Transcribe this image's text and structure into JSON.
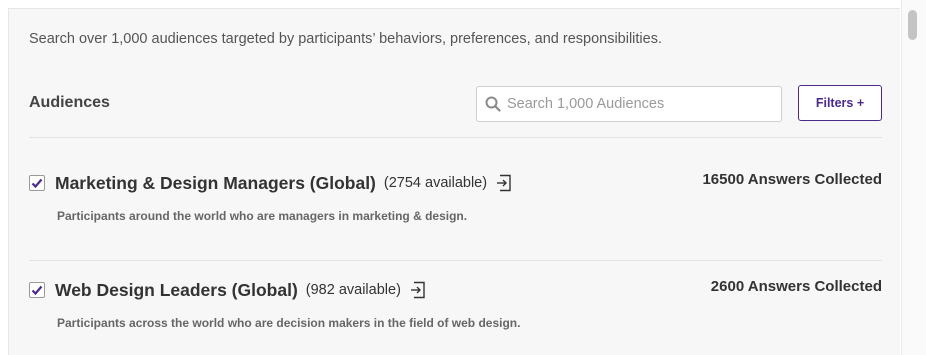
{
  "intro_text": "Search over 1,000 audiences targeted by participants’ behaviors, preferences, and responsibilities.",
  "section_title": "Audiences",
  "search": {
    "placeholder": "Search 1,000 Audiences",
    "icon": "search-icon"
  },
  "filters_label": "Filters +",
  "accent_color": "#4b2a8a",
  "audiences": [
    {
      "name": "Marketing & Design Managers (Global)",
      "available": "(2754 available)",
      "answers": "16500 Answers Collected",
      "description": "Participants around the world who are managers in marketing & design.",
      "checked": true
    },
    {
      "name": "Web Design Leaders (Global)",
      "available": "(982 available)",
      "answers": "2600 Answers Collected",
      "description": "Participants across the world who are decision makers in the field of web design.",
      "checked": true
    }
  ]
}
